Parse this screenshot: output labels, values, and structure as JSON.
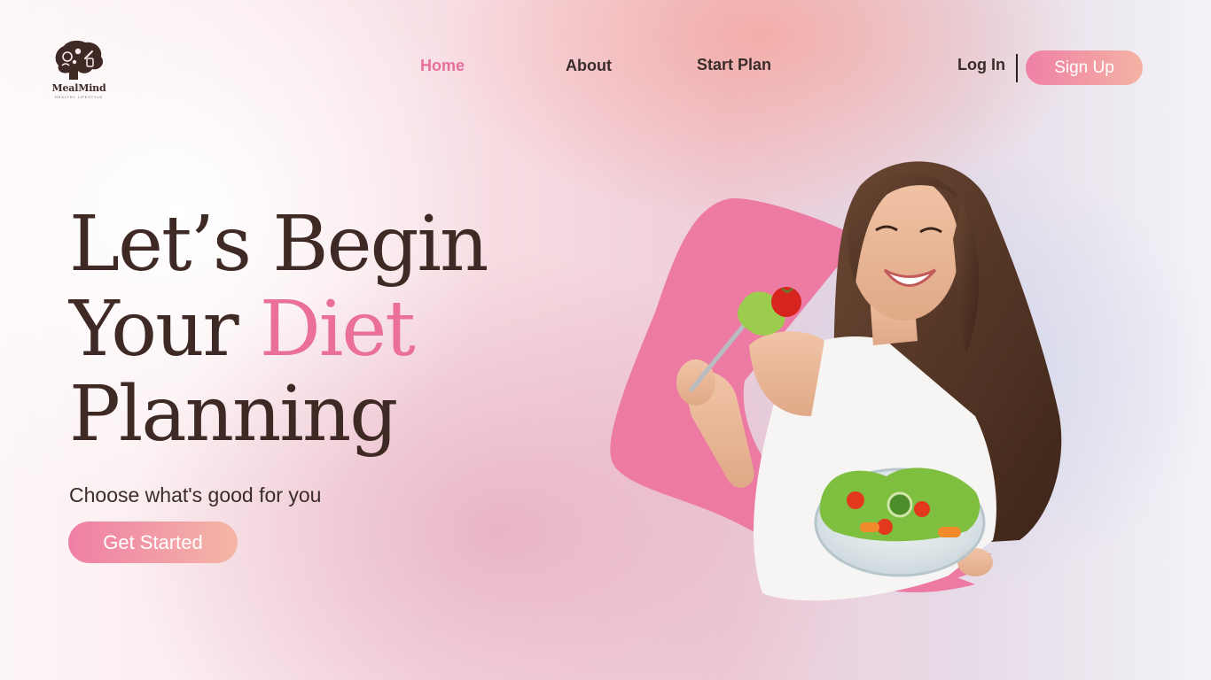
{
  "brand": {
    "name": "MealMind",
    "tagline": "HEALTHY LIFESTYLE"
  },
  "nav": {
    "items": [
      {
        "label": "Home",
        "active": true
      },
      {
        "label": "About",
        "active": false
      },
      {
        "label": "Start Plan",
        "active": false
      }
    ],
    "login_label": "Log In",
    "signup_label": "Sign Up"
  },
  "hero": {
    "title_line1": "Let’s Begin",
    "title_line2_a": "Your ",
    "title_line2_b": "Diet",
    "title_line3": "Planning",
    "subtitle": "Choose what's good for you",
    "cta_label": "Get Started"
  },
  "colors": {
    "accent": "#e56f9c",
    "text_dark": "#3e2925",
    "button_gradient_start": "#ef7fa5",
    "button_gradient_end": "#f4b6a6"
  },
  "icons": {
    "logo": "head-with-food-icon",
    "hero_image": "woman-eating-salad-illustration"
  }
}
